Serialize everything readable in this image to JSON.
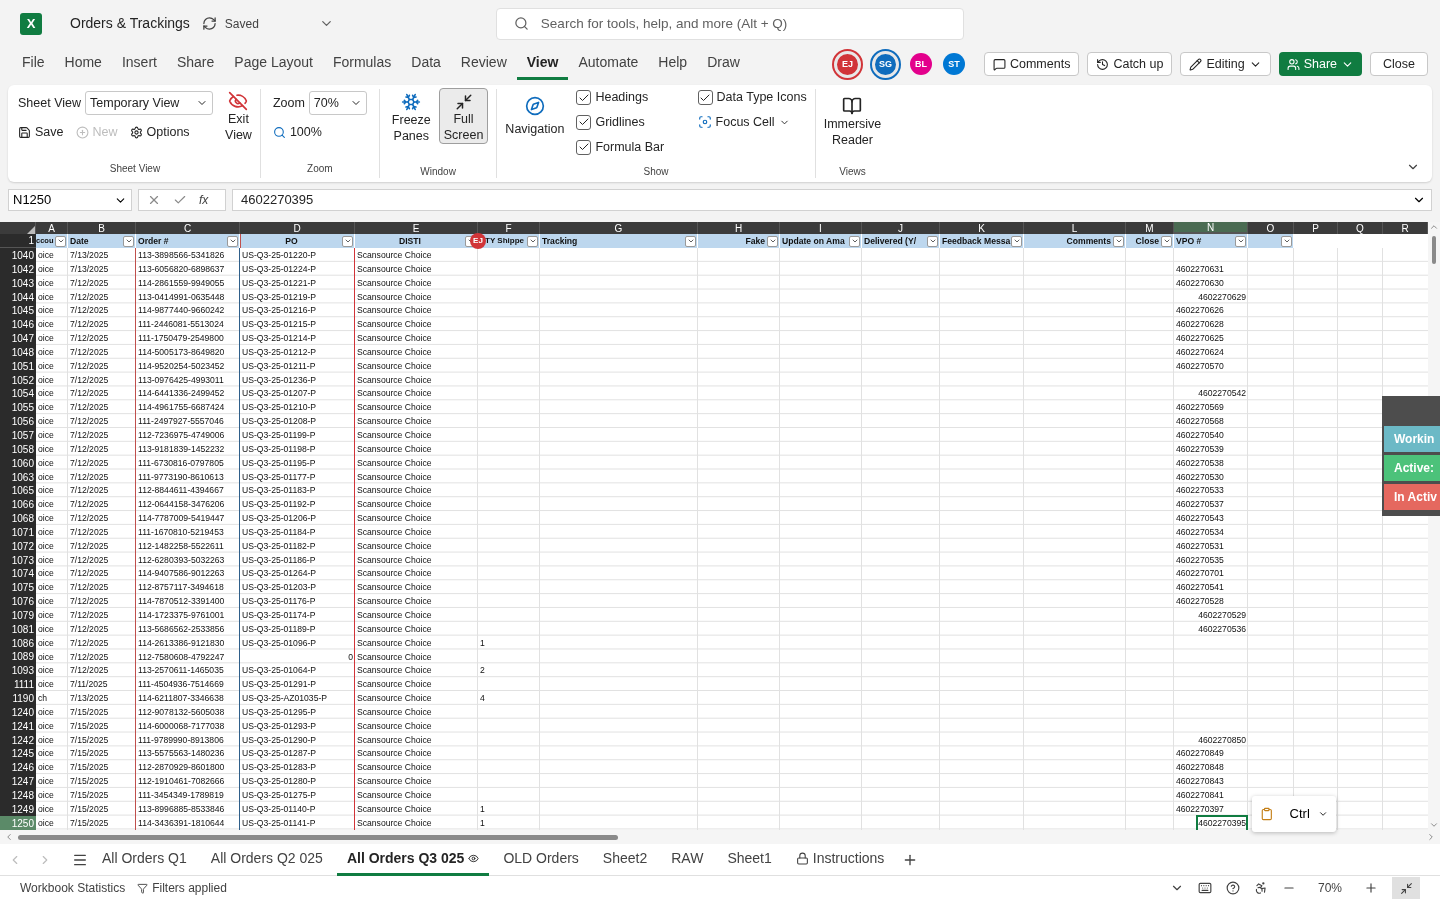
{
  "title_bar": {
    "logo": "X",
    "file_name": "Orders & Trackings",
    "save_status": "Saved",
    "search_placeholder": "Search for tools, help, and more (Alt + Q)"
  },
  "menu_tabs": [
    {
      "label": "File",
      "selected": false
    },
    {
      "label": "Home",
      "selected": false
    },
    {
      "label": "Insert",
      "selected": false
    },
    {
      "label": "Share",
      "selected": false
    },
    {
      "label": "Page Layout",
      "selected": false
    },
    {
      "label": "Formulas",
      "selected": false
    },
    {
      "label": "Data",
      "selected": false
    },
    {
      "label": "Review",
      "selected": false
    },
    {
      "label": "View",
      "selected": true
    },
    {
      "label": "Automate",
      "selected": false
    },
    {
      "label": "Help",
      "selected": false
    },
    {
      "label": "Draw",
      "selected": false
    }
  ],
  "collaborators": [
    {
      "initials": "EJ",
      "color": "#d13438",
      "ring": true
    },
    {
      "initials": "SG",
      "color": "#0f6cbd",
      "ring": true
    },
    {
      "initials": "BL",
      "color": "#e3008c",
      "ring": false
    },
    {
      "initials": "ST",
      "color": "#0078d4",
      "ring": false
    }
  ],
  "actions": {
    "comments": "Comments",
    "catch_up": "Catch up",
    "editing": "Editing",
    "share": "Share",
    "close": "Close"
  },
  "ribbon": {
    "sheet_view": {
      "label": "Sheet View",
      "view_label": "Sheet View",
      "view_select": "Temporary View",
      "save": "Save",
      "new": {
        "label": "New",
        "disabled": true
      },
      "options": "Options",
      "exit": [
        "Exit",
        "View"
      ]
    },
    "zoom": {
      "label": "Zoom",
      "zoom_label": "Zoom",
      "zoom_select": "70%",
      "hundred": "100%"
    },
    "window": {
      "label": "Window",
      "freeze": [
        "Freeze",
        "Panes"
      ],
      "full_screen": {
        "lines": [
          "Full",
          "Screen"
        ],
        "on": true
      }
    },
    "show": {
      "label": "Show",
      "navigation": "Navigation",
      "checks": [
        {
          "label": "Headings",
          "checked": true
        },
        {
          "label": "Gridlines",
          "checked": true
        },
        {
          "label": "Formula Bar",
          "checked": true
        },
        {
          "label": "Data Type Icons",
          "checked": true
        }
      ],
      "focus_cell": "Focus Cell"
    },
    "views": {
      "label": "Views",
      "immersive": [
        "Immersive",
        "Reader"
      ]
    }
  },
  "formula_bar": {
    "name_box": "N1250",
    "fx": "fx",
    "value": "4602270395"
  },
  "sheet": {
    "columns": [
      {
        "letter": "A",
        "selected": false
      },
      {
        "letter": "B",
        "selected": false
      },
      {
        "letter": "C",
        "selected": false
      },
      {
        "letter": "D",
        "selected": false
      },
      {
        "letter": "E",
        "selected": false
      },
      {
        "letter": "F",
        "selected": false
      },
      {
        "letter": "G",
        "selected": false
      },
      {
        "letter": "H",
        "selected": false
      },
      {
        "letter": "I",
        "selected": false
      },
      {
        "letter": "J",
        "selected": false
      },
      {
        "letter": "K",
        "selected": false
      },
      {
        "letter": "L",
        "selected": false
      },
      {
        "letter": "M",
        "selected": false
      },
      {
        "letter": "N",
        "selected": true
      },
      {
        "letter": "O",
        "selected": false
      },
      {
        "letter": "P",
        "selected": false
      },
      {
        "letter": "Q",
        "selected": false
      },
      {
        "letter": "R",
        "selected": false
      }
    ],
    "header_row": "1",
    "headers": [
      "ccou",
      "Date",
      "Order #",
      "PO",
      "DISTI",
      "TY Shippe",
      "Tracking",
      "Fake",
      "Update on Ama",
      "Delivered (Y/",
      "Feedback Messa",
      "Comments",
      "Close",
      "VPO #"
    ],
    "header_marker": {
      "initials": "EJ",
      "color": "#d13438"
    },
    "rows": [
      {
        "row": "1040",
        "a": "oice",
        "date": "7/13/2025",
        "order": "113-3898566-5341826",
        "po": {
          "value": "US-Q3-25-01220-P",
          "kind": "text"
        },
        "disti": "Scansource Choice",
        "selected": false
      },
      {
        "row": "1042",
        "a": "oice",
        "date": "7/13/2025",
        "order": "113-6056820-6898637",
        "po": {
          "value": "US-Q3-25-01224-P",
          "kind": "text"
        },
        "disti": "Scansource Choice",
        "vpo": {
          "value": "4602270631",
          "kind": "text"
        },
        "selected": false
      },
      {
        "row": "1043",
        "a": "oice",
        "date": "7/12/2025",
        "order": "114-2861559-9949055",
        "po": {
          "value": "US-Q3-25-01221-P",
          "kind": "text"
        },
        "disti": "Scansource Choice",
        "vpo": {
          "value": "4602270630",
          "kind": "text"
        },
        "selected": false
      },
      {
        "row": "1044",
        "a": "oice",
        "date": "7/12/2025",
        "order": "113-0414991-0635448",
        "po": {
          "value": "US-Q3-25-01219-P",
          "kind": "text"
        },
        "disti": "Scansource Choice",
        "vpo": {
          "value": "4602270629",
          "kind": "number"
        },
        "selected": false
      },
      {
        "row": "1045",
        "a": "oice",
        "date": "7/12/2025",
        "order": "114-9877440-9660242",
        "po": {
          "value": "US-Q3-25-01216-P",
          "kind": "text"
        },
        "disti": "Scansource Choice",
        "vpo": {
          "value": "4602270626",
          "kind": "text"
        },
        "selected": false
      },
      {
        "row": "1046",
        "a": "oice",
        "date": "7/12/2025",
        "order": "111-2446081-5513024",
        "po": {
          "value": "US-Q3-25-01215-P",
          "kind": "text"
        },
        "disti": "Scansource Choice",
        "vpo": {
          "value": "4602270628",
          "kind": "text"
        },
        "selected": false
      },
      {
        "row": "1047",
        "a": "oice",
        "date": "7/12/2025",
        "order": "111-1750479-2549800",
        "po": {
          "value": "US-Q3-25-01214-P",
          "kind": "text"
        },
        "disti": "Scansource Choice",
        "vpo": {
          "value": "4602270625",
          "kind": "text"
        },
        "selected": false
      },
      {
        "row": "1048",
        "a": "oice",
        "date": "7/12/2025",
        "order": "114-5005173-8649820",
        "po": {
          "value": "US-Q3-25-01212-P",
          "kind": "text"
        },
        "disti": "Scansource Choice",
        "vpo": {
          "value": "4602270624",
          "kind": "text"
        },
        "selected": false
      },
      {
        "row": "1051",
        "a": "oice",
        "date": "7/12/2025",
        "order": "114-9520254-5023452",
        "po": {
          "value": "US-Q3-25-01211-P",
          "kind": "text"
        },
        "disti": "Scansource Choice",
        "vpo": {
          "value": "4602270570",
          "kind": "text"
        },
        "selected": false
      },
      {
        "row": "1052",
        "a": "oice",
        "date": "7/12/2025",
        "order": "113-0976425-4993011",
        "po": {
          "value": "US-Q3-25-01236-P",
          "kind": "text"
        },
        "disti": "Scansource Choice",
        "selected": false
      },
      {
        "row": "1054",
        "a": "oice",
        "date": "7/12/2025",
        "order": "114-6441336-2499452",
        "po": {
          "value": "US-Q3-25-01207-P",
          "kind": "text"
        },
        "disti": "Scansource Choice",
        "vpo": {
          "value": "4602270542",
          "kind": "number"
        },
        "selected": false
      },
      {
        "row": "1055",
        "a": "oice",
        "date": "7/12/2025",
        "order": "114-4961755-6687424",
        "po": {
          "value": "US-Q3-25-01210-P",
          "kind": "text"
        },
        "disti": "Scansource Choice",
        "vpo": {
          "value": "4602270569",
          "kind": "text"
        },
        "selected": false
      },
      {
        "row": "1056",
        "a": "oice",
        "date": "7/12/2025",
        "order": "111-2497927-5557046",
        "po": {
          "value": "US-Q3-25-01208-P",
          "kind": "text"
        },
        "disti": "Scansource Choice",
        "vpo": {
          "value": "4602270568",
          "kind": "text"
        },
        "selected": false
      },
      {
        "row": "1057",
        "a": "oice",
        "date": "7/12/2025",
        "order": "112-7236975-4749006",
        "po": {
          "value": "US-Q3-25-01199-P",
          "kind": "text"
        },
        "disti": "Scansource Choice",
        "vpo": {
          "value": "4602270540",
          "kind": "text"
        },
        "selected": false
      },
      {
        "row": "1058",
        "a": "oice",
        "date": "7/12/2025",
        "order": "113-9181839-1452232",
        "po": {
          "value": "US-Q3-25-01198-P",
          "kind": "text"
        },
        "disti": "Scansource Choice",
        "vpo": {
          "value": "4602270539",
          "kind": "text"
        },
        "selected": false
      },
      {
        "row": "1060",
        "a": "oice",
        "date": "7/12/2025",
        "order": "111-6730816-0797805",
        "po": {
          "value": "US-Q3-25-01195-P",
          "kind": "text"
        },
        "disti": "Scansource Choice",
        "vpo": {
          "value": "4602270538",
          "kind": "text"
        },
        "selected": false
      },
      {
        "row": "1063",
        "a": "oice",
        "date": "7/12/2025",
        "order": "111-9773190-8610613",
        "po": {
          "value": "US-Q3-25-01177-P",
          "kind": "text"
        },
        "disti": "Scansource Choice",
        "vpo": {
          "value": "4602270530",
          "kind": "text"
        },
        "selected": false
      },
      {
        "row": "1065",
        "a": "oice",
        "date": "7/12/2025",
        "order": "112-8844611-4394667",
        "po": {
          "value": "US-Q3-25-01183-P",
          "kind": "text"
        },
        "disti": "Scansource Choice",
        "vpo": {
          "value": "4602270533",
          "kind": "text"
        },
        "selected": false
      },
      {
        "row": "1066",
        "a": "oice",
        "date": "7/12/2025",
        "order": "112-0644158-3476206",
        "po": {
          "value": "US-Q3-25-01192-P",
          "kind": "text"
        },
        "disti": "Scansource Choice",
        "vpo": {
          "value": "4602270537",
          "kind": "text"
        },
        "selected": false
      },
      {
        "row": "1068",
        "a": "oice",
        "date": "7/12/2025",
        "order": "114-7787009-5419447",
        "po": {
          "value": "US-Q3-25-01206-P",
          "kind": "text"
        },
        "disti": "Scansource Choice",
        "vpo": {
          "value": "4602270543",
          "kind": "text"
        },
        "selected": false
      },
      {
        "row": "1071",
        "a": "oice",
        "date": "7/12/2025",
        "order": "111-1670810-5219453",
        "po": {
          "value": "US-Q3-25-01184-P",
          "kind": "text"
        },
        "disti": "Scansource Choice",
        "vpo": {
          "value": "4602270534",
          "kind": "text"
        },
        "selected": false
      },
      {
        "row": "1072",
        "a": "oice",
        "date": "7/12/2025",
        "order": "112-1482258-5522611",
        "po": {
          "value": "US-Q3-25-01182-P",
          "kind": "text"
        },
        "disti": "Scansource Choice",
        "vpo": {
          "value": "4602270531",
          "kind": "text"
        },
        "selected": false
      },
      {
        "row": "1073",
        "a": "oice",
        "date": "7/12/2025",
        "order": "112-6280393-5032263",
        "po": {
          "value": "US-Q3-25-01186-P",
          "kind": "text"
        },
        "disti": "Scansource Choice",
        "vpo": {
          "value": "4602270535",
          "kind": "text"
        },
        "selected": false
      },
      {
        "row": "1074",
        "a": "oice",
        "date": "7/12/2025",
        "order": "114-9407586-9012263",
        "po": {
          "value": "US-Q3-25-01264-P",
          "kind": "text"
        },
        "disti": "Scansource Choice",
        "vpo": {
          "value": "4602270701",
          "kind": "text"
        },
        "selected": false
      },
      {
        "row": "1075",
        "a": "oice",
        "date": "7/12/2025",
        "order": "112-8757117-3494618",
        "po": {
          "value": "US-Q3-25-01203-P",
          "kind": "text"
        },
        "disti": "Scansource Choice",
        "vpo": {
          "value": "4602270541",
          "kind": "text"
        },
        "selected": false
      },
      {
        "row": "1076",
        "a": "oice",
        "date": "7/12/2025",
        "order": "114-7870512-3391400",
        "po": {
          "value": "US-Q3-25-01176-P",
          "kind": "text"
        },
        "disti": "Scansource Choice",
        "vpo": {
          "value": "4602270528",
          "kind": "text"
        },
        "selected": false
      },
      {
        "row": "1079",
        "a": "oice",
        "date": "7/12/2025",
        "order": "114-1723375-9761001",
        "po": {
          "value": "US-Q3-25-01174-P",
          "kind": "text"
        },
        "disti": "Scansource Choice",
        "vpo": {
          "value": "4602270529",
          "kind": "number"
        },
        "selected": false
      },
      {
        "row": "1081",
        "a": "oice",
        "date": "7/12/2025",
        "order": "113-5686562-2533856",
        "po": {
          "value": "US-Q3-25-01189-P",
          "kind": "text"
        },
        "disti": "Scansource Choice",
        "vpo": {
          "value": "4602270536",
          "kind": "number"
        },
        "selected": false
      },
      {
        "row": "1086",
        "a": "oice",
        "date": "7/12/2025",
        "order": "114-2613386-9121830",
        "po": {
          "value": "US-Q3-25-01096-P",
          "kind": "text"
        },
        "disti": "Scansource Choice",
        "qty": "1",
        "selected": false
      },
      {
        "row": "1089",
        "a": "oice",
        "date": "7/12/2025",
        "order": "112-7580608-4792247",
        "po": {
          "value": "0",
          "kind": "number"
        },
        "disti": "Scansource Choice",
        "selected": false
      },
      {
        "row": "1093",
        "a": "oice",
        "date": "7/12/2025",
        "order": "113-2570611-1465035",
        "po": {
          "value": "US-Q3-25-01064-P",
          "kind": "text"
        },
        "disti": "Scansource Choice",
        "qty": "2",
        "selected": false
      },
      {
        "row": "1111",
        "a": "oice",
        "date": "7/11/2025",
        "order": "111-4504936-7514669",
        "po": {
          "value": "US-Q3-25-01291-P",
          "kind": "text"
        },
        "disti": "Scansource Choice",
        "selected": false
      },
      {
        "row": "1190",
        "a": "ch",
        "date": "7/13/2025",
        "order": "114-6211807-3346638",
        "po": {
          "value": "US-Q3-25-AZ01035-P",
          "kind": "text"
        },
        "disti": "Scansource Choice",
        "qty": "4",
        "selected": false
      },
      {
        "row": "1240",
        "a": "oice",
        "date": "7/15/2025",
        "order": "112-9078132-5605038",
        "po": {
          "value": "US-Q3-25-01295-P",
          "kind": "text"
        },
        "disti": "Scansource Choice",
        "selected": false
      },
      {
        "row": "1241",
        "a": "oice",
        "date": "7/15/2025",
        "order": "114-6000068-7177038",
        "po": {
          "value": "US-Q3-25-01293-P",
          "kind": "text"
        },
        "disti": "Scansource Choice",
        "selected": false
      },
      {
        "row": "1242",
        "a": "oice",
        "date": "7/15/2025",
        "order": "111-9789990-8913806",
        "po": {
          "value": "US-Q3-25-01290-P",
          "kind": "text"
        },
        "disti": "Scansource Choice",
        "vpo": {
          "value": "4602270850",
          "kind": "number"
        },
        "selected": false
      },
      {
        "row": "1245",
        "a": "oice",
        "date": "7/15/2025",
        "order": "113-5575563-1480236",
        "po": {
          "value": "US-Q3-25-01287-P",
          "kind": "text"
        },
        "disti": "Scansource Choice",
        "vpo": {
          "value": "4602270849",
          "kind": "text"
        },
        "selected": false
      },
      {
        "row": "1246",
        "a": "oice",
        "date": "7/15/2025",
        "order": "112-2870929-8601800",
        "po": {
          "value": "US-Q3-25-01283-P",
          "kind": "text"
        },
        "disti": "Scansource Choice",
        "vpo": {
          "value": "4602270848",
          "kind": "text"
        },
        "selected": false
      },
      {
        "row": "1247",
        "a": "oice",
        "date": "7/15/2025",
        "order": "112-1910461-7082666",
        "po": {
          "value": "US-Q3-25-01280-P",
          "kind": "text"
        },
        "disti": "Scansource Choice",
        "vpo": {
          "value": "4602270843",
          "kind": "text"
        },
        "selected": false
      },
      {
        "row": "1248",
        "a": "oice",
        "date": "7/15/2025",
        "order": "111-3454349-1789819",
        "po": {
          "value": "US-Q3-25-01275-P",
          "kind": "text"
        },
        "disti": "Scansource Choice",
        "vpo": {
          "value": "4602270841",
          "kind": "text"
        },
        "selected": false
      },
      {
        "row": "1249",
        "a": "oice",
        "date": "7/15/2025",
        "order": "113-8996885-8533846",
        "po": {
          "value": "US-Q3-25-01140-P",
          "kind": "text"
        },
        "disti": "Scansource Choice",
        "qty": "1",
        "vpo": {
          "value": "4602270397",
          "kind": "text"
        },
        "selected": false
      },
      {
        "row": "1250",
        "a": "oice",
        "date": "7/15/2025",
        "order": "114-3436391-1810644",
        "po": {
          "value": "US-Q3-25-01141-P",
          "kind": "text"
        },
        "disti": "Scansource Choice",
        "qty": "1",
        "vpo": {
          "value": "4602270395",
          "kind": "number"
        },
        "selected": true
      }
    ]
  },
  "status_panel": [
    {
      "label": "Workin",
      "color": "#6cb9c6"
    },
    {
      "label": "Active:",
      "color": "#4cc27a"
    },
    {
      "label": "In Activ",
      "color": "#e5685f"
    }
  ],
  "paste_popup": {
    "label": "Ctrl"
  },
  "sheet_tabs": [
    {
      "label": "All Orders Q1",
      "selected": false
    },
    {
      "label": "All Orders Q2 025",
      "selected": false
    },
    {
      "label": "All Orders Q3 025",
      "selected": true
    },
    {
      "label": "OLD Orders",
      "selected": false
    },
    {
      "label": "Sheet2",
      "selected": false
    },
    {
      "label": "RAW",
      "selected": false
    },
    {
      "label": "Sheet1",
      "selected": false
    },
    {
      "label": "Instructions",
      "selected": false,
      "locked": true
    }
  ],
  "status_bar": {
    "statistics": "Workbook Statistics",
    "filters": "Filters applied",
    "zoom": "70%"
  }
}
